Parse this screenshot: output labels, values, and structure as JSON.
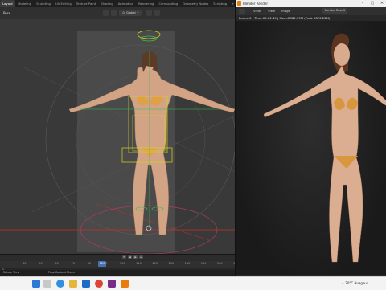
{
  "blender": {
    "workspace_tabs": [
      "Layout",
      "Modeling",
      "Sculpting",
      "UV Editing",
      "Texture Paint",
      "Shading",
      "Animation",
      "Rendering",
      "Compositing",
      "Geometry Nodes",
      "Scripting",
      "+"
    ],
    "active_tab": 0,
    "mode_label": "Pose",
    "orientation": "Global"
  },
  "timeline": {
    "left_label": "0",
    "ticks": [
      "40",
      "50",
      "60",
      "70",
      "80",
      "90",
      "100",
      "110",
      "120",
      "130",
      "140",
      "150",
      "160",
      "170"
    ],
    "current_frame": "120",
    "play_controls": [
      "⏮",
      "◀",
      "▶",
      "⏭"
    ]
  },
  "statusbar": {
    "left": "Rotate View",
    "middle": "Pose Context Menu"
  },
  "render_window": {
    "title": "Blender Render",
    "menus": [
      "View",
      "View",
      "Image"
    ],
    "slot": "Render Result",
    "info": "Frame:0 | Time:00:02.49 | Mem:2382.95M (Peak 2876.22M)"
  },
  "taskbar": {
    "weather_temp": "20°C",
    "weather_text": "Nuageux"
  },
  "colors": {
    "accent": "#4772b3",
    "bone_yellow": "#d9d21f",
    "bone_green": "#35c24a",
    "bone_red": "#c0322e"
  }
}
